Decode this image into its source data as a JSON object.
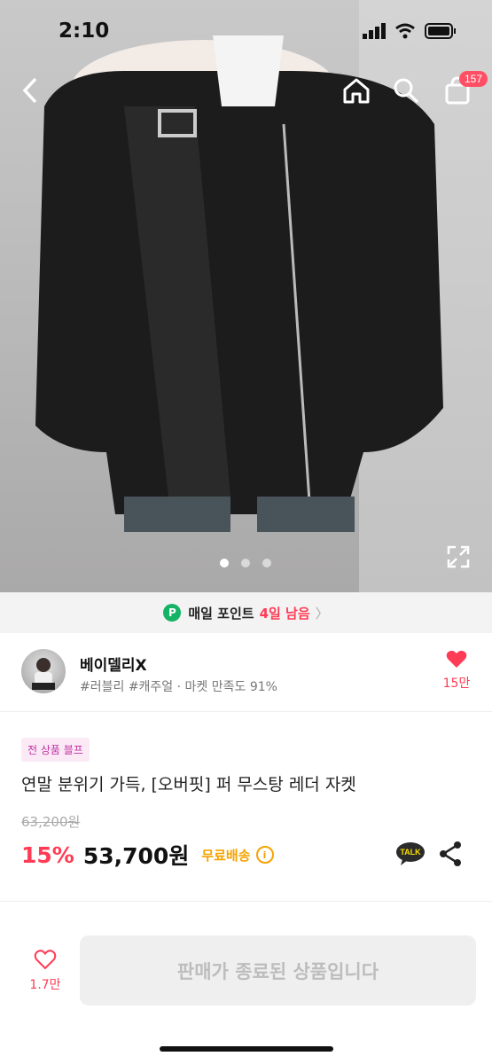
{
  "status_bar": {
    "time": "2:10"
  },
  "nav": {
    "cart_count": "157"
  },
  "hero": {
    "slide_count": 3,
    "active_slide": 1
  },
  "points_bar": {
    "icon_letter": "P",
    "label": "매일 포인트",
    "highlight": "4일 남음",
    "chevron": "〉"
  },
  "shop": {
    "name": "베이델리X",
    "tags": "#러블리 #캐주얼 · 마켓 만족도 91%",
    "likes": "15만"
  },
  "product": {
    "badge": "전 상품 블프",
    "title": "연말 분위기 가득, [오버핏] 퍼 무스탕 레더 자켓",
    "original_price": "63,200원",
    "discount": "15%",
    "price": "53,700원",
    "shipping": "무료배송",
    "info_icon": "i",
    "talk_label": "TALK"
  },
  "bottom": {
    "likes": "1.7만",
    "sold_out_label": "판매가 종료된 상품입니다"
  },
  "colors": {
    "accent": "#ff3b55",
    "shipping": "#f6a300",
    "point_green": "#14b365"
  }
}
